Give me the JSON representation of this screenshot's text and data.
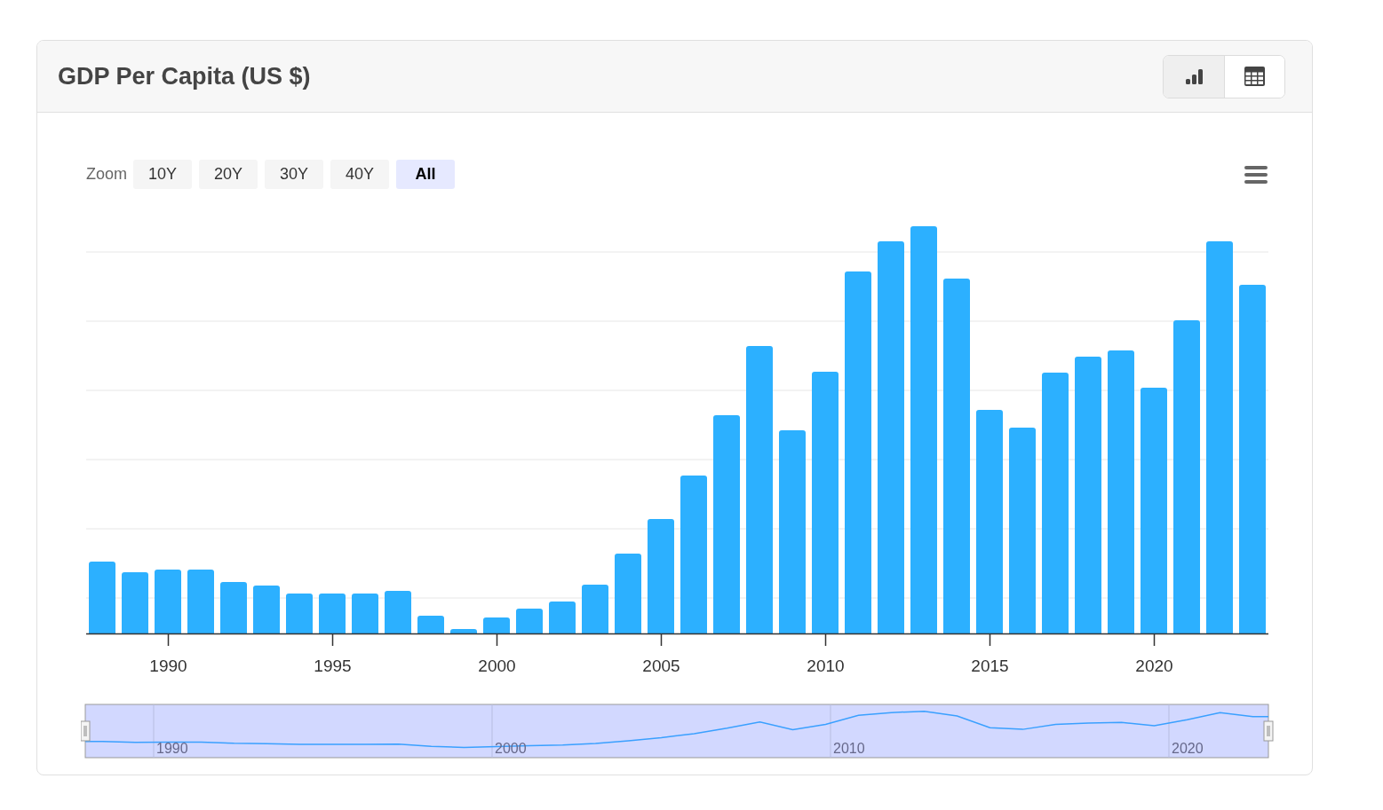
{
  "card": {
    "title": "GDP Per Capita (US $)",
    "view_buttons": [
      {
        "kind": "chart",
        "selected": true
      },
      {
        "kind": "table",
        "selected": false
      }
    ]
  },
  "zoom": {
    "label": "Zoom",
    "buttons": [
      {
        "label": "10Y",
        "selected": false
      },
      {
        "label": "20Y",
        "selected": false
      },
      {
        "label": "30Y",
        "selected": false
      },
      {
        "label": "40Y",
        "selected": false
      },
      {
        "label": "All",
        "selected": true
      }
    ]
  },
  "chart": {
    "x_labels": [
      "1990",
      "1995",
      "2000",
      "2005",
      "2010",
      "2015",
      "2020"
    ],
    "navigator_labels": [
      "1990",
      "2000",
      "2010",
      "2020"
    ]
  }
}
